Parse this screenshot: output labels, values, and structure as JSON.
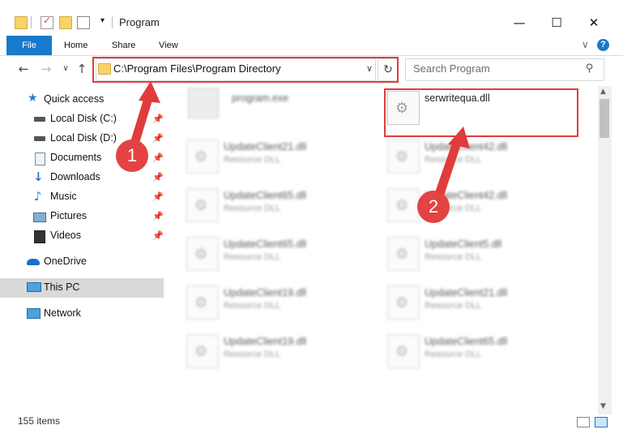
{
  "window": {
    "title": "Program",
    "minimize": "—",
    "maximize": "☐",
    "close": "✕"
  },
  "ribbon": {
    "tabs": [
      "File",
      "Home",
      "Share",
      "View"
    ],
    "expand": "∨",
    "help": "?"
  },
  "nav_buttons": {
    "back": "←",
    "forward": "→",
    "recent": "∨",
    "up": "↑"
  },
  "address": {
    "path": "C:\\Program Files\\Program Directory",
    "dropdown": "∨",
    "refresh": "↻"
  },
  "search": {
    "placeholder": "Search Program",
    "icon": "search-icon"
  },
  "nav_pane": {
    "items": [
      {
        "label": "Quick access",
        "icon": "star-icon"
      },
      {
        "label": "Local Disk (C:)",
        "icon": "drive-icon",
        "pinned": true
      },
      {
        "label": "Local Disk (D:)",
        "icon": "drive-icon",
        "pinned": true
      },
      {
        "label": "Documents",
        "icon": "documents-icon",
        "pinned": true
      },
      {
        "label": "Downloads",
        "icon": "download-icon",
        "pinned": true
      },
      {
        "label": "Music",
        "icon": "music-icon",
        "pinned": true
      },
      {
        "label": "Pictures",
        "icon": "pictures-icon",
        "pinned": true
      },
      {
        "label": "Videos",
        "icon": "videos-icon",
        "pinned": true
      },
      {
        "label": "OneDrive",
        "icon": "cloud-icon"
      },
      {
        "label": "This PC",
        "icon": "computer-icon",
        "selected": true
      },
      {
        "label": "Network",
        "icon": "network-icon"
      }
    ]
  },
  "files": {
    "left_column": [
      {
        "name": "program.exe",
        "type": ""
      },
      {
        "name": "UpdateClient21.dll",
        "type": "Resource DLL"
      },
      {
        "name": "UpdateClient65.dll",
        "type": "Resource DLL"
      },
      {
        "name": "UpdateClient65.dll",
        "type": "Resource DLL"
      },
      {
        "name": "UpdateClient19.dll",
        "type": "Resource DLL"
      },
      {
        "name": "UpdateClient19.dll",
        "type": "Resource DLL"
      }
    ],
    "right_column": [
      {
        "name": "serwritequa.dll",
        "type": ""
      },
      {
        "name": "UpdateClient42.dll",
        "type": "Resource DLL"
      },
      {
        "name": "UpdateClient42.dll",
        "type": "Resource DLL"
      },
      {
        "name": "UpdateClient5.dll",
        "type": "Resource DLL"
      },
      {
        "name": "UpdateClient21.dll",
        "type": "Resource DLL"
      },
      {
        "name": "UpdateClient65.dll",
        "type": "Resource DLL"
      }
    ]
  },
  "annotations": {
    "badge_1": "1",
    "badge_2": "2",
    "color": "#e03c3c"
  },
  "status": {
    "item_count": "155 items"
  }
}
